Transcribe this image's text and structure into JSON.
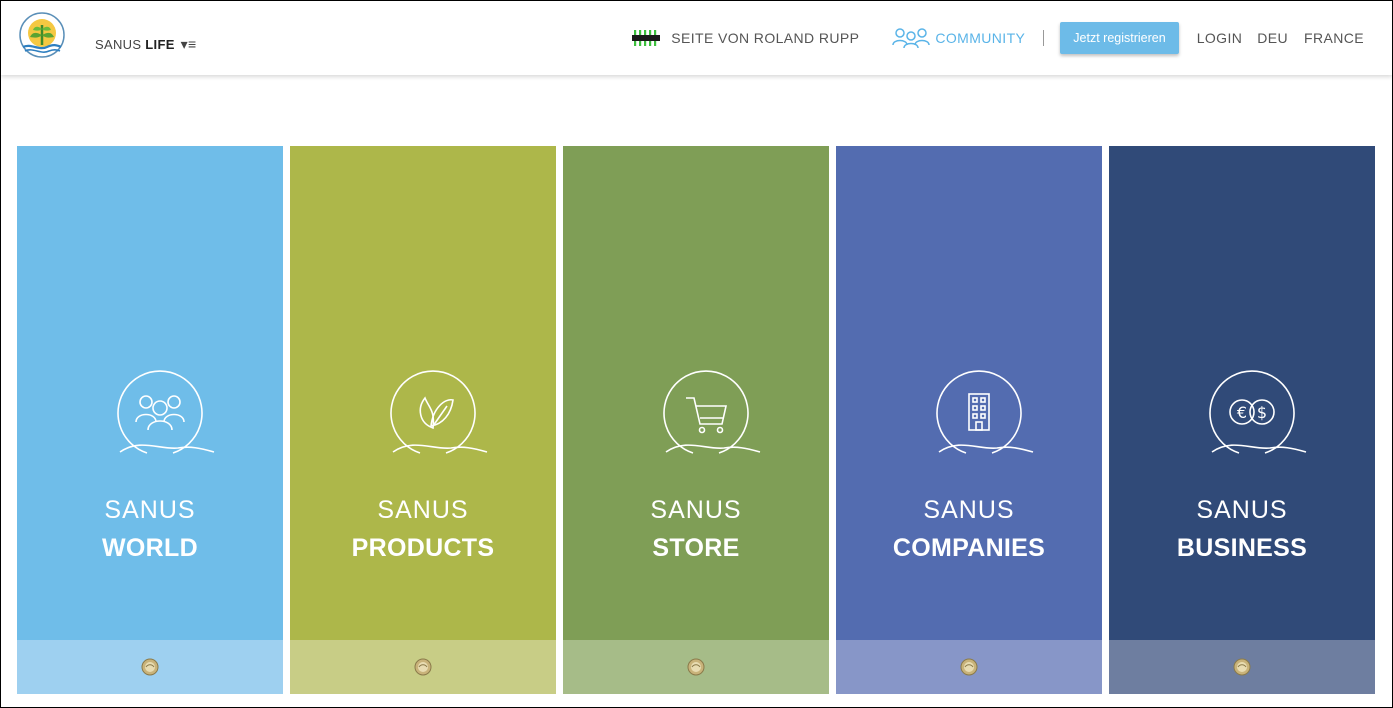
{
  "header": {
    "brand_prefix": "SANUS",
    "brand_suffix": "LIFE",
    "seite_label": "SEITE VON ROLAND RUPP",
    "community_label": "COMMUNITY",
    "register_label": "Jetzt registrieren",
    "login_label": "LOGIN",
    "lang_de": "DEU",
    "lang_fr": "FRANCE"
  },
  "tiles": [
    {
      "line1": "SANUS",
      "line2": "WORLD",
      "icon": "people-icon",
      "color": "#6fbde9",
      "foot_color": "#9ed0f0"
    },
    {
      "line1": "SANUS",
      "line2": "PRODUCTS",
      "icon": "leaf-icon",
      "color": "#adb74a",
      "foot_color": "#c8cd86"
    },
    {
      "line1": "SANUS",
      "line2": "STORE",
      "icon": "cart-icon",
      "color": "#7f9e56",
      "foot_color": "#a6bc88"
    },
    {
      "line1": "SANUS",
      "line2": "COMPANIES",
      "icon": "building-icon",
      "color": "#536cb0",
      "foot_color": "#8796c8"
    },
    {
      "line1": "SANUS",
      "line2": "BUSINESS",
      "icon": "currency-icon",
      "color": "#304a78",
      "foot_color": "#6e7ea0"
    }
  ],
  "colors": {
    "accent": "#5ab4e8",
    "register_bg": "#6dbbe8"
  }
}
